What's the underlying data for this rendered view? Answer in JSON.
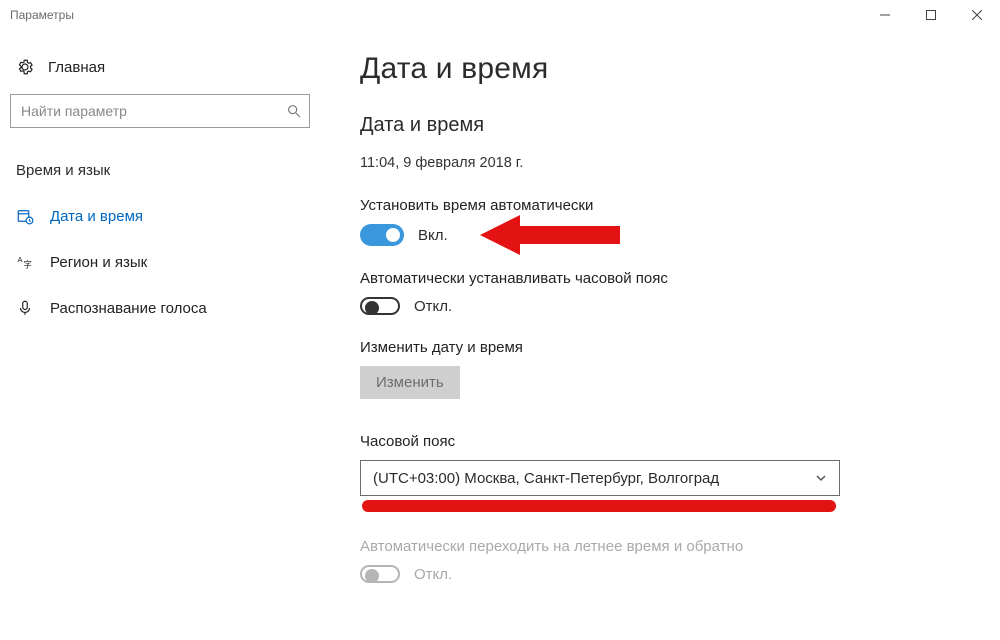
{
  "window": {
    "title": "Параметры"
  },
  "sidebar": {
    "home": "Главная",
    "search_placeholder": "Найти параметр",
    "group_title": "Время и язык",
    "items": [
      {
        "label": "Дата и время"
      },
      {
        "label": "Регион и язык"
      },
      {
        "label": "Распознавание голоса"
      }
    ]
  },
  "main": {
    "page_title": "Дата и время",
    "section_title": "Дата и время",
    "timestamp": "11:04, 9 февраля 2018 г.",
    "auto_time": {
      "label": "Установить время автоматически",
      "state_text": "Вкл.",
      "on": true
    },
    "auto_tz": {
      "label": "Автоматически устанавливать часовой пояс",
      "state_text": "Откл.",
      "on": false
    },
    "change": {
      "label": "Изменить дату и время",
      "button": "Изменить"
    },
    "timezone": {
      "label": "Часовой пояс",
      "selected": "(UTC+03:00) Москва, Санкт-Петербург, Волгоград"
    },
    "dst": {
      "label": "Автоматически переходить на летнее время и обратно",
      "state_text": "Откл."
    }
  }
}
